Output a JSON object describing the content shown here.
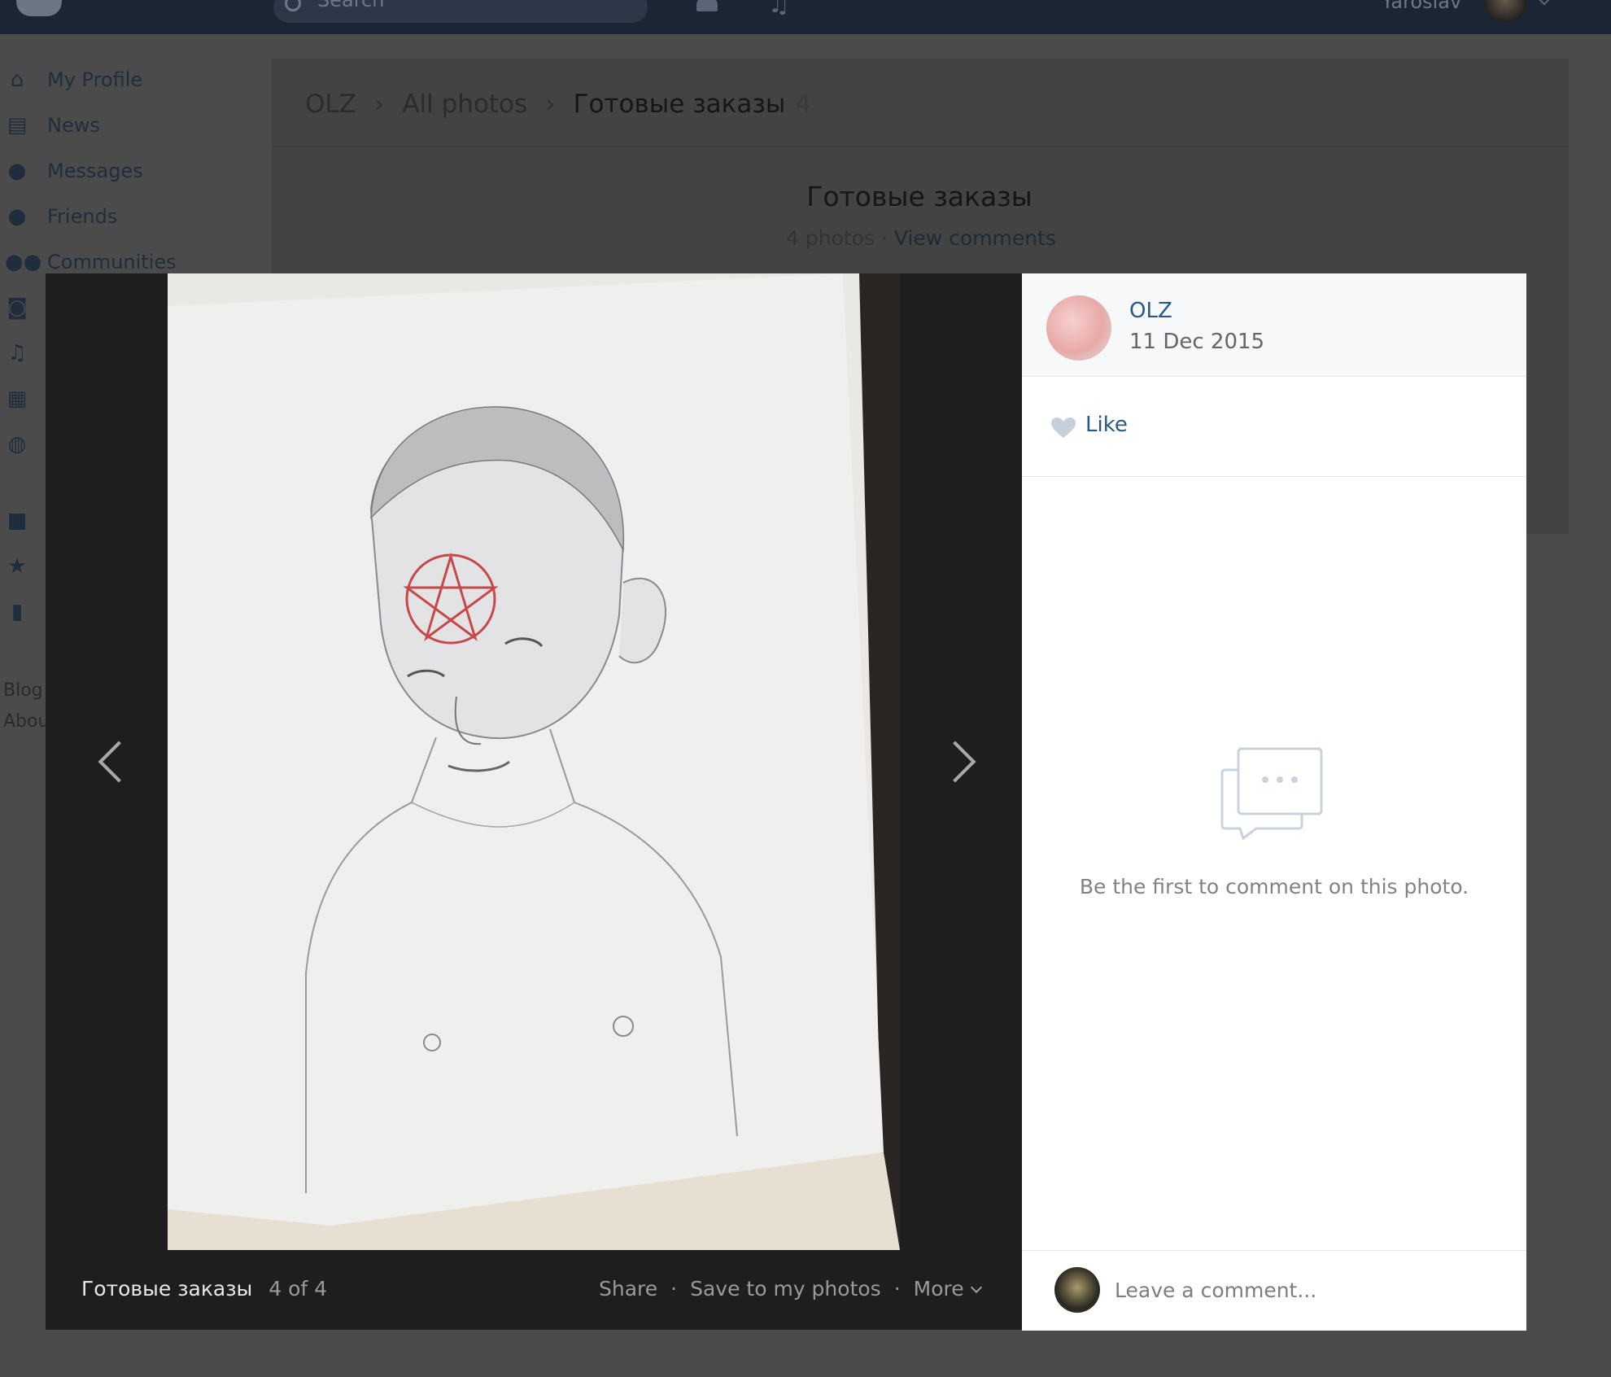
{
  "header": {
    "search_placeholder": "Search",
    "user_name": "Yaroslav"
  },
  "sidebar": {
    "items": [
      {
        "label": "My Profile",
        "icon": "home-icon"
      },
      {
        "label": "News",
        "icon": "news-icon"
      },
      {
        "label": "Messages",
        "icon": "messages-icon"
      },
      {
        "label": "Friends",
        "icon": "friends-icon"
      },
      {
        "label": "Communities",
        "icon": "communities-icon"
      },
      {
        "label": "",
        "icon": "camera-icon"
      },
      {
        "label": "",
        "icon": "music-icon"
      },
      {
        "label": "",
        "icon": "video-icon"
      },
      {
        "label": "",
        "icon": "games-icon"
      },
      {
        "label": "",
        "icon": "bag-icon"
      },
      {
        "label": "",
        "icon": "star-icon"
      },
      {
        "label": "",
        "icon": "document-icon"
      }
    ],
    "footer": [
      "Blog",
      "Abou"
    ]
  },
  "album_page": {
    "breadcrumb": [
      "OLZ",
      "All photos",
      "Готовые заказы"
    ],
    "breadcrumb_count": "4",
    "title": "Готовые заказы",
    "photo_count": "4 photos",
    "view_comments": "View comments"
  },
  "viewer": {
    "album_name": "Готовые заказы",
    "position": "4 of 4",
    "actions": {
      "share": "Share",
      "save": "Save to my photos",
      "more": "More"
    },
    "separator": "·"
  },
  "panel": {
    "owner_name": "OLZ",
    "date": "11 Dec 2015",
    "like_label": "Like",
    "empty_text": "Be the first to comment on this photo.",
    "comment_placeholder": "Leave a comment..."
  },
  "colors": {
    "header_bg": "#1b2533",
    "link": "#2a5885",
    "viewer_bg": "#1e1e1e"
  }
}
